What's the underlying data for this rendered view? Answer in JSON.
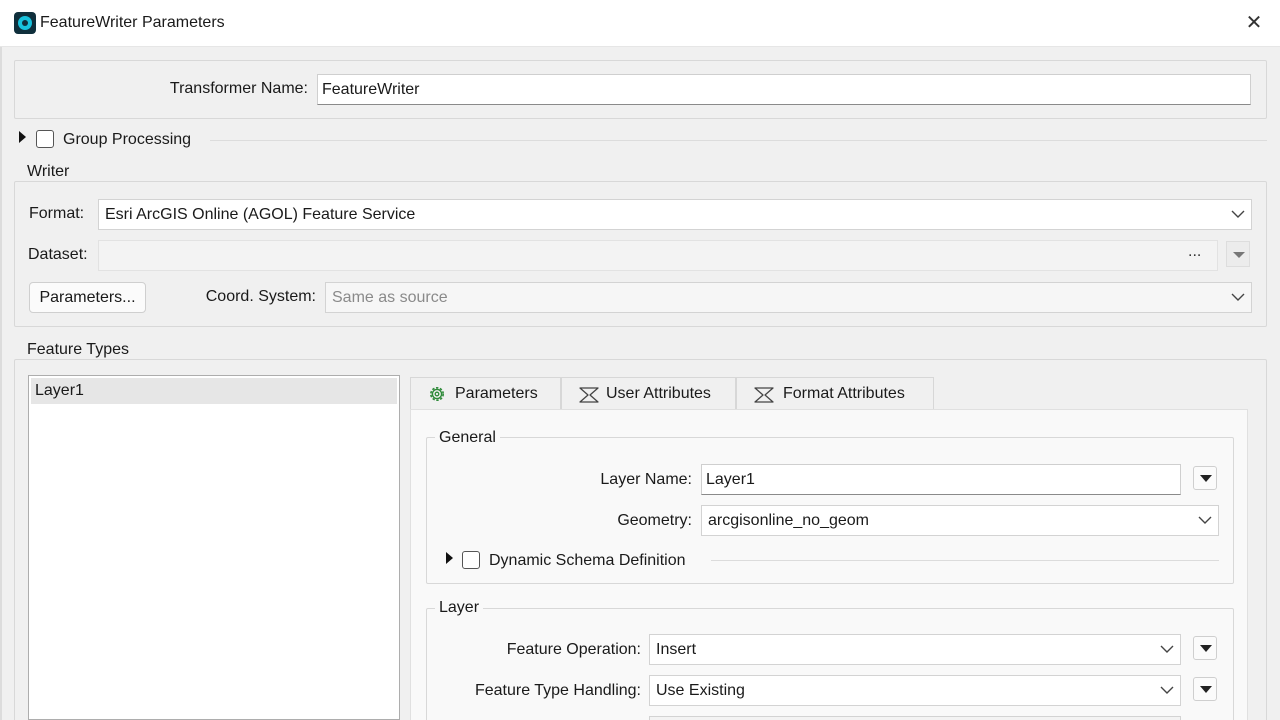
{
  "window": {
    "title": "FeatureWriter Parameters",
    "close_glyph": "✕"
  },
  "transformer": {
    "label": "Transformer Name:",
    "value": "FeatureWriter"
  },
  "group_processing": {
    "label": "Group Processing",
    "checked": false
  },
  "writer": {
    "legend": "Writer",
    "format_label": "Format:",
    "format_value": "Esri ArcGIS Online (AGOL) Feature Service",
    "dataset_label": "Dataset:",
    "dataset_value": "",
    "dataset_browse": "...",
    "parameters_button": "Parameters...",
    "coord_label": "Coord. System:",
    "coord_value": "Same as source"
  },
  "feature_types": {
    "legend": "Feature Types",
    "items": [
      "Layer1"
    ],
    "selected": "Layer1"
  },
  "tabs": [
    {
      "label": "Parameters",
      "icon": "gear-icon",
      "active": true
    },
    {
      "label": "User Attributes",
      "icon": "sigma-icon",
      "active": false
    },
    {
      "label": "Format Attributes",
      "icon": "sigma-icon",
      "active": false
    }
  ],
  "general": {
    "legend": "General",
    "layer_name_label": "Layer Name:",
    "layer_name_value": "Layer1",
    "geometry_label": "Geometry:",
    "geometry_value": "arcgisonline_no_geom",
    "dynamic_schema_label": "Dynamic Schema Definition",
    "dynamic_schema_checked": false
  },
  "layer": {
    "legend": "Layer",
    "feature_operation_label": "Feature Operation:",
    "feature_operation_value": "Insert",
    "feature_type_handling_label": "Feature Type Handling:",
    "feature_type_handling_value": "Use Existing"
  },
  "colors": {
    "app_icon": "#18c2dd",
    "background": "#f0f0f0",
    "titlebar": "#ffffff"
  }
}
